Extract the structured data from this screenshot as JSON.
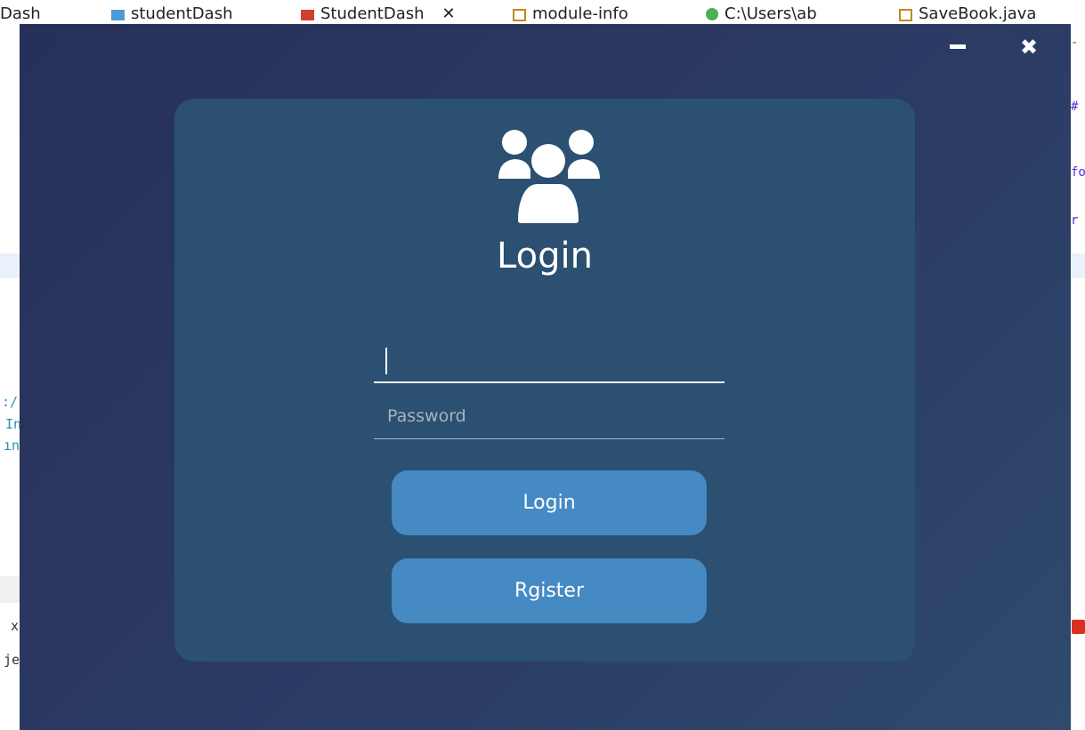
{
  "background_tabs": [
    {
      "label": "Dash"
    },
    {
      "label": "studentDash"
    },
    {
      "label": "StudentDash"
    },
    {
      "label": "module-info"
    },
    {
      "label": "C:\\Users\\ab"
    },
    {
      "label": "SaveBook.java"
    }
  ],
  "background_tab_close": "✕",
  "background_text": {
    "left_lines": [
      ":/",
      "In",
      "ın"
    ],
    "left_bottom": [
      "x",
      "je"
    ],
    "right_lines": [
      "-",
      "#",
      "fo",
      "r"
    ]
  },
  "window": {
    "minimize_icon": "minimize-icon",
    "close_symbol": "✖"
  },
  "login_card": {
    "icon": "users-group-icon",
    "title": "Login",
    "username_value": "",
    "password_placeholder": "Password",
    "login_button": "Login",
    "register_button": "Rgister"
  },
  "colors": {
    "window_bg": "#2b3b64",
    "card_bg": "#2b5071",
    "button_bg": "#458ac3",
    "text": "#ffffff"
  }
}
